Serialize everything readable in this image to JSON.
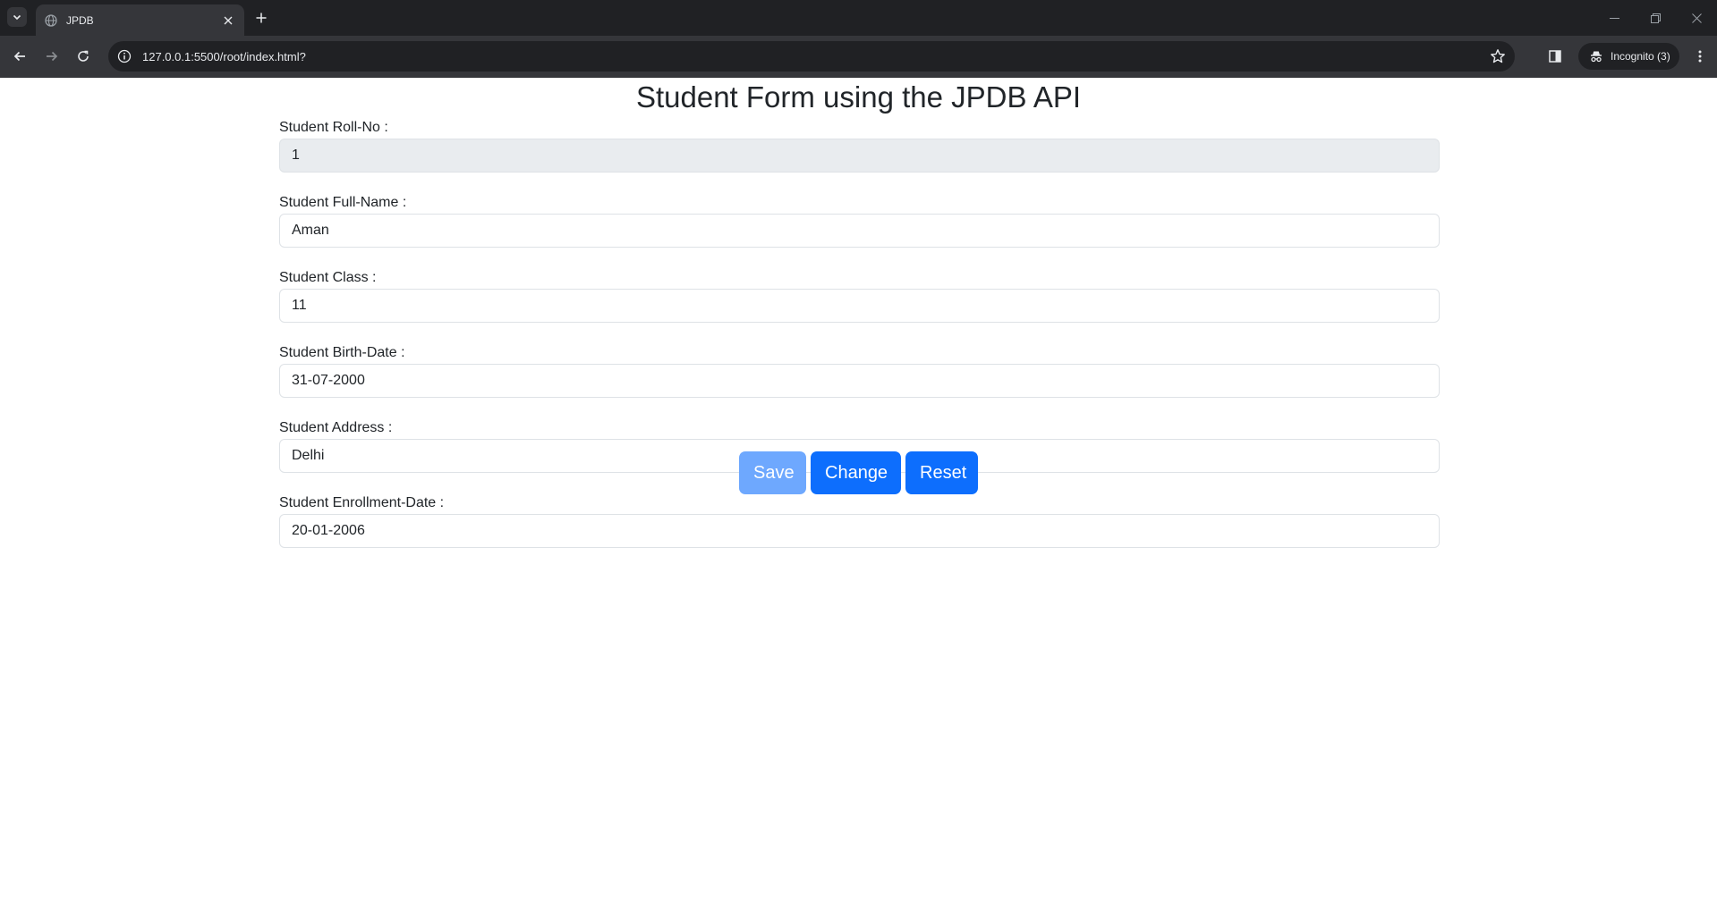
{
  "browser": {
    "tab": {
      "title": "JPDB"
    },
    "omnibox": {
      "url": "127.0.0.1:5500/root/index.html?"
    },
    "incognito": {
      "label": "Incognito (3)"
    }
  },
  "page": {
    "title": "Student Form using the JPDB API",
    "fields": [
      {
        "label": "Student Roll-No :",
        "value": "1",
        "disabled": true
      },
      {
        "label": "Student Full-Name :",
        "value": "Aman",
        "disabled": false
      },
      {
        "label": "Student Class :",
        "value": "11",
        "disabled": false
      },
      {
        "label": "Student Birth-Date :",
        "value": "31-07-2000",
        "disabled": false
      },
      {
        "label": "Student Address :",
        "value": "Delhi",
        "disabled": false
      },
      {
        "label": "Student Enrollment-Date :",
        "value": "20-01-2006",
        "disabled": false
      }
    ],
    "buttons": {
      "save": {
        "label": "Save",
        "disabled": true
      },
      "change": {
        "label": "Change",
        "disabled": false
      },
      "reset": {
        "label": "Reset",
        "disabled": false
      }
    }
  },
  "colors": {
    "primary": "#0d6efd",
    "primary_disabled": "#6ea8fe",
    "chrome_dark": "#202124",
    "chrome_toolbar": "#35363a"
  },
  "icons": [
    "tab-search-icon",
    "globe-icon",
    "close-icon",
    "plus-icon",
    "back-arrow-icon",
    "forward-arrow-icon",
    "reload-icon",
    "info-icon",
    "star-icon",
    "side-panel-icon",
    "incognito-icon",
    "kebab-menu-icon",
    "minimize-icon",
    "restore-icon",
    "window-close-icon"
  ]
}
